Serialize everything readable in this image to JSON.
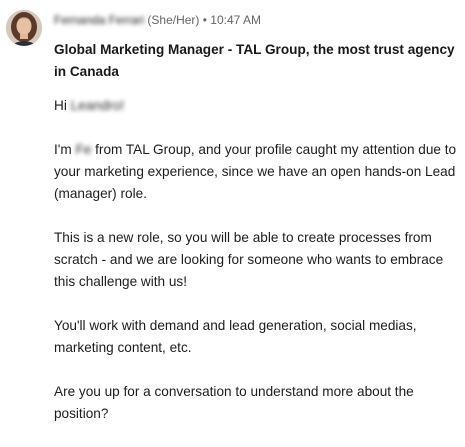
{
  "sender": {
    "name": "Fernanda Ferrari",
    "pronouns": "(She/Her)",
    "separator": "•",
    "timestamp": "10:47 AM"
  },
  "message": {
    "subject": "Global Marketing Manager - TAL Group, the most trust agency in Canada",
    "greeting_prefix": "Hi ",
    "greeting_name": "Leandro!",
    "para1_prefix": "I'm ",
    "para1_name": "Fe",
    "para1_rest": " from TAL Group, and your profile caught my attention due to your marketing experience, since we have an open hands-on Lead (manager) role.",
    "para2": "This is a new role, so you will be able to create processes from scratch - and we are looking for someone who wants to embrace this challenge with us!",
    "para3": "You'll work with demand and lead generation, social medias, marketing content, etc.",
    "para4": "Are you up for a conversation to understand more about the position?"
  }
}
